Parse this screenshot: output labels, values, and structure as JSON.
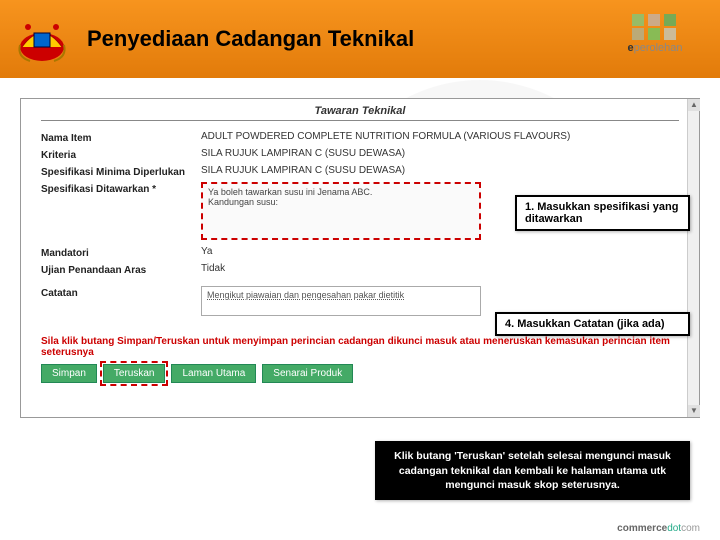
{
  "header": {
    "title": "Penyediaan Cadangan Teknikal",
    "brand_prefix": "e",
    "brand_main": "perolehan"
  },
  "section": {
    "title": "Tawaran Teknikal"
  },
  "form": {
    "nama_item": {
      "label": "Nama Item",
      "value": "ADULT POWDERED COMPLETE NUTRITION FORMULA (VARIOUS FLAVOURS)"
    },
    "kriteria": {
      "label": "Kriteria",
      "value": "SILA RUJUK LAMPIRAN C (SUSU DEWASA)"
    },
    "spes_min": {
      "label": "Spesifikasi Minima Diperlukan",
      "value": "SILA RUJUK LAMPIRAN C (SUSU DEWASA)"
    },
    "spes_offer": {
      "label": "Spesifikasi Ditawarkan *",
      "value_line1": "Ya boleh tawarkan susu ini Jenama ABC.",
      "value_line2": "Kandungan susu:"
    },
    "mandatori": {
      "label": "Mandatori",
      "value": "Ya"
    },
    "ujian": {
      "label": "Ujian Penandaan Aras",
      "value": "Tidak"
    },
    "catatan": {
      "label": "Catatan",
      "value": "Mengikut piawaian dan pengesahan pakar dietitik"
    }
  },
  "warning": "Sila klik butang Simpan/Teruskan untuk menyimpan perincian cadangan dikunci masuk atau meneruskan kemasukan perincian item seterusnya",
  "buttons": {
    "simpan": "Simpan",
    "teruskan": "Teruskan",
    "laman": "Laman Utama",
    "senarai": "Senarai Produk"
  },
  "callouts": {
    "c1": "1. Masukkan spesifikasi yang ditawarkan",
    "c4": "4. Masukkan Catatan (jika ada)",
    "main": "Klik butang 'Teruskan' setelah selesai mengunci masuk cadangan teknikal dan kembali ke halaman utama utk mengunci masuk skop seterusnya."
  },
  "footer": {
    "brand1": "commerce",
    "brand2": "dot",
    "brand3": "com"
  }
}
